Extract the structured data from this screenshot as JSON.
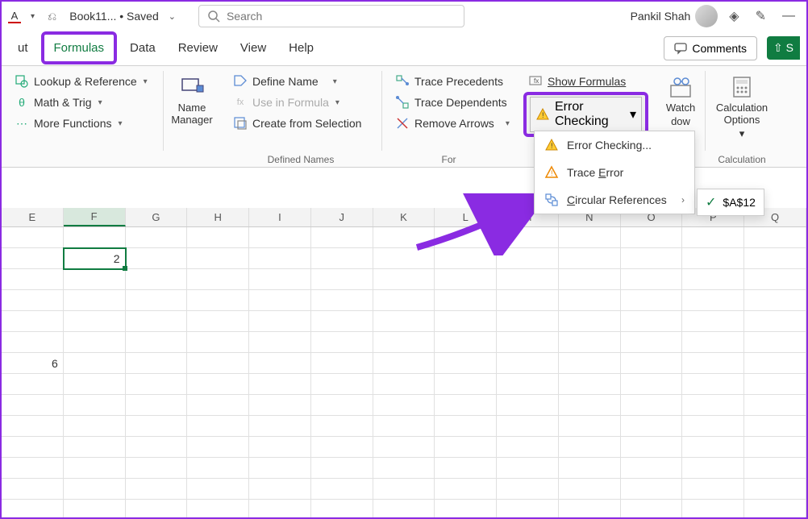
{
  "titlebar": {
    "font_letter": "A",
    "doc_name": "Book11... • Saved",
    "search_placeholder": "Search",
    "user_name": "Pankil Shah"
  },
  "tabs": {
    "cut_partial": "ut",
    "formulas": "Formulas",
    "data": "Data",
    "review": "Review",
    "view": "View",
    "help": "Help",
    "comments": "Comments",
    "share_partial": "S"
  },
  "ribbon": {
    "lookup": "Lookup & Reference",
    "math": "Math & Trig",
    "more_fn": "More Functions",
    "name_mgr": "Name\nManager",
    "define_name": "Define Name",
    "use_in_formula": "Use in Formula",
    "create_sel": "Create from Selection",
    "defined_names_label": "Defined Names",
    "trace_prec": "Trace Precedents",
    "trace_dep": "Trace Dependents",
    "remove_arrows": "Remove Arrows",
    "show_formulas": "Show Formulas",
    "error_checking": "Error Checking",
    "formula_aud_label": "For",
    "watch": "Watch",
    "watch_window": "dow",
    "calc_options": "Calculation\nOptions",
    "calc_label": "Calculation"
  },
  "dropdown": {
    "error_checking": "Error Checking...",
    "trace_error": "Trace Error",
    "circular_refs": "Circular References"
  },
  "submenu": {
    "cell_ref": "$A$12"
  },
  "sheet": {
    "columns": [
      "E",
      "F",
      "G",
      "H",
      "I",
      "J",
      "K",
      "L",
      "M",
      "N",
      "O",
      "P",
      "Q"
    ],
    "active_col_index": 1,
    "rows": [
      {
        "cells": [
          "",
          "",
          "",
          "",
          "",
          "",
          "",
          "",
          "",
          "",
          "",
          "",
          ""
        ]
      },
      {
        "cells": [
          "",
          "2",
          "",
          "",
          "",
          "",
          "",
          "",
          "",
          "",
          "",
          "",
          ""
        ],
        "active": 1
      },
      {
        "cells": [
          "",
          "",
          "",
          "",
          "",
          "",
          "",
          "",
          "",
          "",
          "",
          "",
          ""
        ]
      },
      {
        "cells": [
          "",
          "",
          "",
          "",
          "",
          "",
          "",
          "",
          "",
          "",
          "",
          "",
          ""
        ]
      },
      {
        "cells": [
          "",
          "",
          "",
          "",
          "",
          "",
          "",
          "",
          "",
          "",
          "",
          "",
          ""
        ]
      },
      {
        "cells": [
          "",
          "",
          "",
          "",
          "",
          "",
          "",
          "",
          "",
          "",
          "",
          "",
          ""
        ]
      },
      {
        "cells": [
          "6",
          "",
          "",
          "",
          "",
          "",
          "",
          "",
          "",
          "",
          "",
          "",
          ""
        ]
      },
      {
        "cells": [
          "",
          "",
          "",
          "",
          "",
          "",
          "",
          "",
          "",
          "",
          "",
          "",
          ""
        ]
      },
      {
        "cells": [
          "",
          "",
          "",
          "",
          "",
          "",
          "",
          "",
          "",
          "",
          "",
          "",
          ""
        ]
      },
      {
        "cells": [
          "",
          "",
          "",
          "",
          "",
          "",
          "",
          "",
          "",
          "",
          "",
          "",
          ""
        ]
      },
      {
        "cells": [
          "",
          "",
          "",
          "",
          "",
          "",
          "",
          "",
          "",
          "",
          "",
          "",
          ""
        ]
      },
      {
        "cells": [
          "",
          "",
          "",
          "",
          "",
          "",
          "",
          "",
          "",
          "",
          "",
          "",
          ""
        ]
      },
      {
        "cells": [
          "",
          "",
          "",
          "",
          "",
          "",
          "",
          "",
          "",
          "",
          "",
          "",
          ""
        ]
      },
      {
        "cells": [
          "",
          "",
          "",
          "",
          "",
          "",
          "",
          "",
          "",
          "",
          "",
          "",
          ""
        ]
      }
    ]
  }
}
